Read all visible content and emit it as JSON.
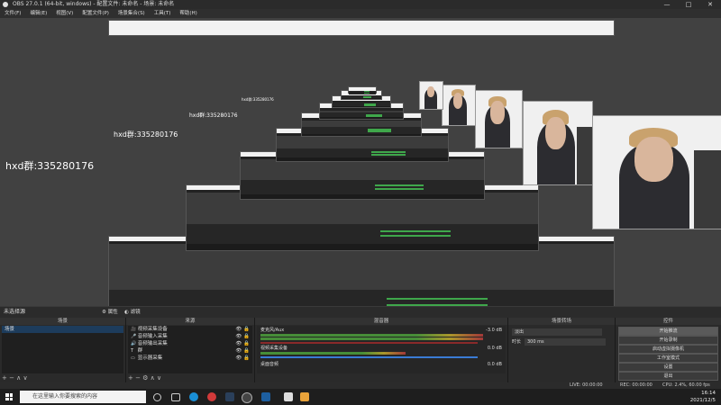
{
  "window": {
    "title": "OBS 27.0.1 (64-bit, windows) - 配置文件: 未命名 - 场景: 未命名",
    "minimize_label": "—",
    "maximize_label": "□",
    "close_label": "✕"
  },
  "menu": [
    "文件(F)",
    "编辑(E)",
    "视图(V)",
    "配置文件(P)",
    "场景集合(S)",
    "工具(T)",
    "帮助(H)"
  ],
  "overlay": {
    "text": "hxd群:335280176"
  },
  "scene_bar": {
    "current_scene": "未选择源",
    "properties_label": "属性",
    "filters_label": "滤镜"
  },
  "panels": {
    "scenes": {
      "title": "场景",
      "items": [
        "场景"
      ],
      "footer": "+ − ∧ ∨"
    },
    "sources": {
      "title": "来源",
      "items": [
        {
          "icon": "🎥",
          "label": "视频采集设备"
        },
        {
          "icon": "🎤",
          "label": "音频输入采集"
        },
        {
          "icon": "🔊",
          "label": "音频输出采集"
        },
        {
          "icon": "T",
          "label": "群"
        },
        {
          "icon": "▭",
          "label": "显示器采集"
        }
      ],
      "footer": "+ − ⚙ ∧ ∨"
    },
    "mixer": {
      "title": "混音器",
      "channels": [
        {
          "name": "麦克风/Aux",
          "db": "-3.0 dB"
        },
        {
          "name": "视频采集设备",
          "db": "0.0 dB"
        },
        {
          "name": "桌面音频",
          "db": "0.0 dB"
        }
      ]
    },
    "transitions": {
      "title": "场景转场",
      "type": "淡出",
      "duration_label": "时长",
      "duration_value": "300 ms"
    },
    "controls": {
      "title": "控件",
      "buttons": [
        "开始推流",
        "开始录制",
        "启动虚拟摄像机",
        "工作室模式",
        "设置",
        "退出"
      ]
    }
  },
  "status": {
    "live": "LIVE: 00:00:00",
    "rec": "REC: 00:00:00",
    "cpu": "CPU: 2.4%, 60.00 fps"
  },
  "taskbar": {
    "search_placeholder": "在这里输入你要搜索的内容",
    "time": "16:14",
    "date": "2021/12/5"
  },
  "colors": {
    "accent": "#3a7bd5",
    "meter_green": "#4a9a3a",
    "meter_red": "#b03a3a",
    "background": "#3a3a3a"
  }
}
